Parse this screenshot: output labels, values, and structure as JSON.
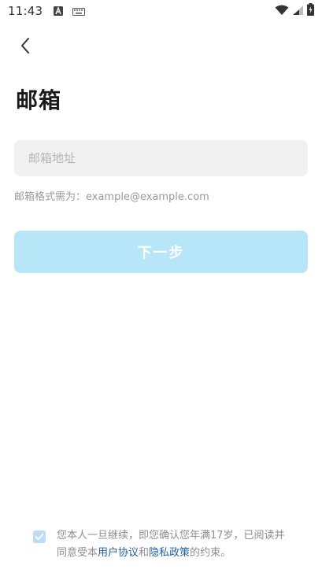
{
  "status_bar": {
    "time": "11:43",
    "icons": [
      "a-square-icon",
      "keyboard-icon",
      "wifi-icon",
      "signal-icon",
      "battery-charging-icon"
    ]
  },
  "header": {
    "back_icon": "chevron-left-icon",
    "title": "邮箱"
  },
  "form": {
    "email_placeholder": "邮箱地址",
    "email_value": "",
    "hint": "邮箱格式需为：example@example.com",
    "next_label": "下一步"
  },
  "agreement": {
    "checked": true,
    "line1": "您本人一旦继续，即您确认您年满17岁，已阅读",
    "line2_prefix": "并同意受本",
    "user_agreement": "用户协议",
    "conjunction": "和",
    "privacy_policy": "隐私政策",
    "line2_suffix": "的约束。"
  },
  "colors": {
    "accent_disabled": "#b6e6f8",
    "link": "#1f5fb4",
    "checkbox": "#bcdcfa"
  }
}
